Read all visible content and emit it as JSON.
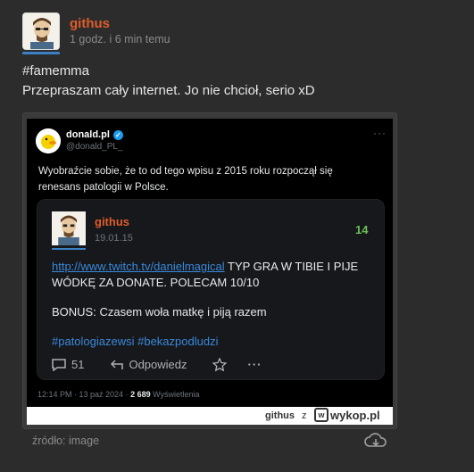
{
  "post": {
    "author": "githus",
    "time": "1 godz. i 6 min temu",
    "tag": "#famemma",
    "body": "Przepraszam cały internet. Jo nie chcioł, serio xD",
    "source_label": "źródło: image"
  },
  "tweet": {
    "name": "donald.pl",
    "handle": "@donald_PL_",
    "text": "Wyobraźcie sobie, że to od tego wpisu z 2015 roku rozpoczął się renesans patologii w Polsce.",
    "footer_time": "12:14 PM · 13 paź 2024 · ",
    "footer_views_count": "2 689",
    "footer_views_label": " Wyświetlenia"
  },
  "quoted": {
    "author": "githus",
    "date": "19.01.15",
    "votes": "14",
    "link": "http://www.twitch.tv/danielmagical",
    "text_rest": " TYP GRA W TIBIE I PIJE WÓDKĘ ZA DONATE. POLECAM 10/10",
    "bonus": "BONUS: Czasem woła matkę i piją razem",
    "tags": "#patologiazewsi #bekazpodludzi",
    "comments": "51",
    "reply_label": "Odpowiedz"
  },
  "watermark": {
    "user": "githus",
    "z": "z",
    "site": "wykop.pl"
  },
  "colors": {
    "author": "#e05c2a",
    "link": "#3b88d8",
    "votes": "#6bbf59",
    "background": "#2c2c2c"
  }
}
